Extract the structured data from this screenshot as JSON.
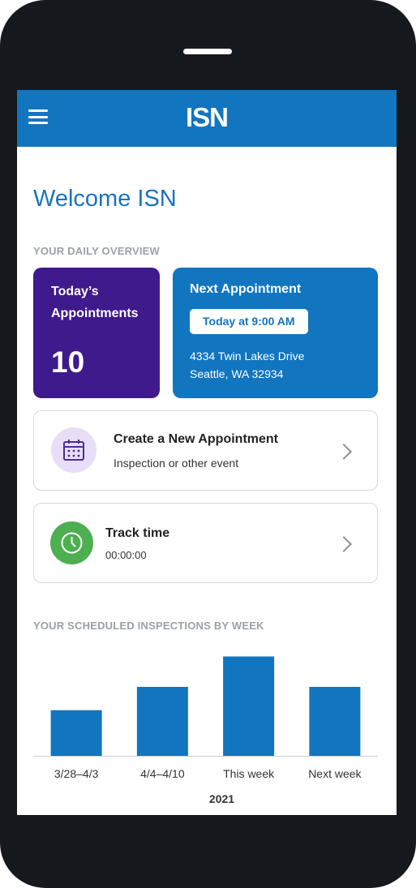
{
  "header": {
    "logo_text": "ISN",
    "brand_color": "#1175c0"
  },
  "welcome": "Welcome ISN",
  "overview": {
    "section_label": "YOUR DAILY OVERVIEW",
    "today": {
      "title": "Today’s Appointments",
      "count": "10",
      "color": "#3f1a8c"
    },
    "next": {
      "title": "Next Appointment",
      "time": "Today at 9:00 AM",
      "address_line1": "4334 Twin Lakes Drive",
      "address_line2": "Seattle, WA 32934"
    }
  },
  "actions": {
    "create": {
      "title": "Create a New Appointment",
      "subtitle": "Inspection or other event",
      "icon": "calendar-icon"
    },
    "track": {
      "title": "Track time",
      "subtitle": "00:00:00",
      "icon": "clock-icon"
    }
  },
  "chart_section_label": "YOUR SCHEDULED  INSPECTIONS BY WEEK",
  "chart_data": {
    "type": "bar",
    "categories": [
      "3/28–4/3",
      "4/4–4/10",
      "This week",
      "Next week"
    ],
    "values": [
      4.5,
      6.8,
      9.8,
      6.8
    ],
    "xlabel": "2021",
    "ylabel": "",
    "ylim": [
      0,
      10
    ],
    "grid": false,
    "bar_color": "#1175c0"
  }
}
